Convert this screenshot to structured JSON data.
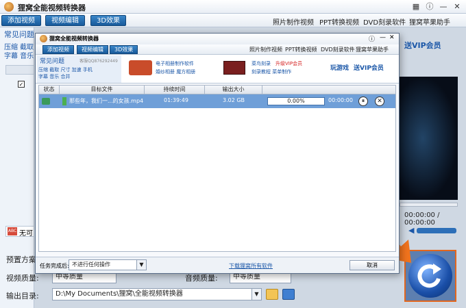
{
  "app": {
    "title": "狸窝全能视频转换器"
  },
  "toolbar": {
    "add_video": "添加视频",
    "edit_video": "视频编辑",
    "effect_3d": "3D效果"
  },
  "top_links": [
    "照片制作视频",
    "PPT转换视频",
    "DVD刻录软件",
    "狸窝苹果助手"
  ],
  "left": {
    "faq": "常见问题",
    "tags_row1": "压缩 截取",
    "tags_row2": "字幕 音乐",
    "no_subtitle": "无可"
  },
  "right": {
    "vip": "送VIP会员",
    "time_display": "00:00:00 / 00:00:00"
  },
  "bottom": {
    "preset_label": "预置方案:",
    "video_quality_label": "视频质量:",
    "video_quality_value": "中等质量",
    "audio_quality_label": "音频质量:",
    "audio_quality_value": "中等质量",
    "output_label": "输出目录:",
    "output_path": "D:\\My Documents\\狸窝\\全能视频转换器"
  },
  "dialog": {
    "title": "狸窝全能视频转换器",
    "toolbar": {
      "add_video": "添加视频",
      "edit_video": "视频编辑",
      "effect_3d": "3D效果"
    },
    "links": [
      "照片制作视频",
      "PPT转换视频",
      "DVD刻录软件",
      "狸窝苹果助手"
    ],
    "faq": "常见问题",
    "qq": "客服QQ876292449",
    "tags1": "压缩 截取 尺寸 加速 手机",
    "tags2": "字幕 音乐 合并",
    "ad1_line1": "电子相册制作软件",
    "ad1_line2": "婚纱相册 魔方相册",
    "ad2_line1": "菜鸟刻录",
    "ad2_vip": "升级VIP会员",
    "ad2_line2": "刻录教程 菜单制作",
    "games": "玩游戏",
    "vip": "送VIP会员",
    "columns": [
      "状态",
      "目标文件",
      "持续时间",
      "输出大小"
    ],
    "row": {
      "file": "那些年，我们一...的女孩.mp4",
      "duration": "01:39:49",
      "size": "3.02 GB",
      "progress": "0.00%",
      "elapsed": "00:00:00"
    },
    "after_label": "任务完成后:",
    "after_value": "不进行任何操作",
    "download_link": "下载狸窝所有软件",
    "cancel": "取消"
  }
}
